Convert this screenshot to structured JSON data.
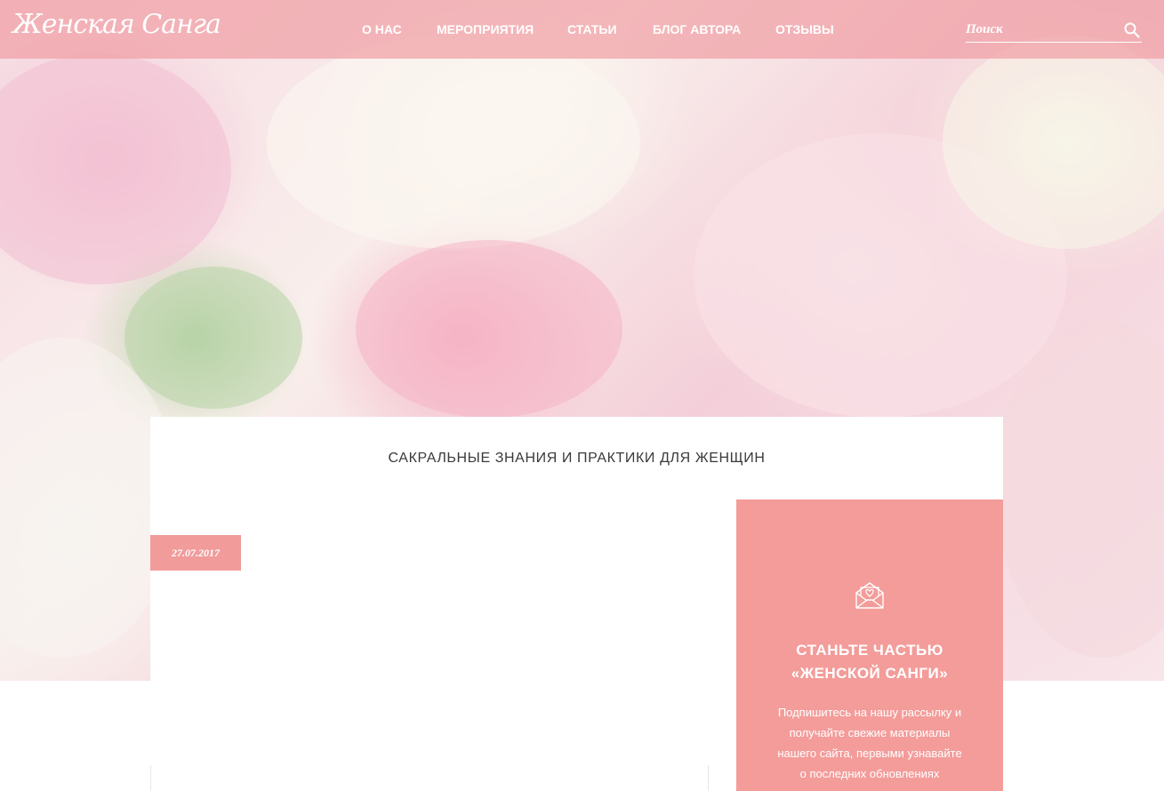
{
  "header": {
    "logo_text": "Женская Санга",
    "nav": [
      {
        "label": "О НАС"
      },
      {
        "label": "МЕРОПРИЯТИЯ"
      },
      {
        "label": "СТАТЬИ"
      },
      {
        "label": "БЛОГ АВТОРА"
      },
      {
        "label": "ОТЗЫВЫ"
      }
    ],
    "search": {
      "placeholder": "Поиск",
      "icon": "search-icon"
    }
  },
  "hero": {
    "image": "pink-and-white-peonies"
  },
  "main": {
    "title": "САКРАЛЬНЫЕ ЗНАНИЯ И ПРАКТИКИ ДЛЯ ЖЕНЩИН",
    "post_date": "27.07.2017"
  },
  "sidebar": {
    "subscribe": {
      "icon": "heart-envelope-icon",
      "title_line1": "СТАНЬТЕ ЧАСТЬЮ",
      "title_line2": "«ЖЕНСКОЙ САНГИ»",
      "text_lines": [
        "Подпишитесь на нашу рассылку и",
        "получайте свежие материалы",
        "нашего сайта, первыми узнавайте",
        "о последних обновлениях"
      ]
    }
  },
  "colors": {
    "header_bg": "#f0a0a5",
    "accent": "#f39c9a",
    "text_dark": "#3a3a3a"
  }
}
